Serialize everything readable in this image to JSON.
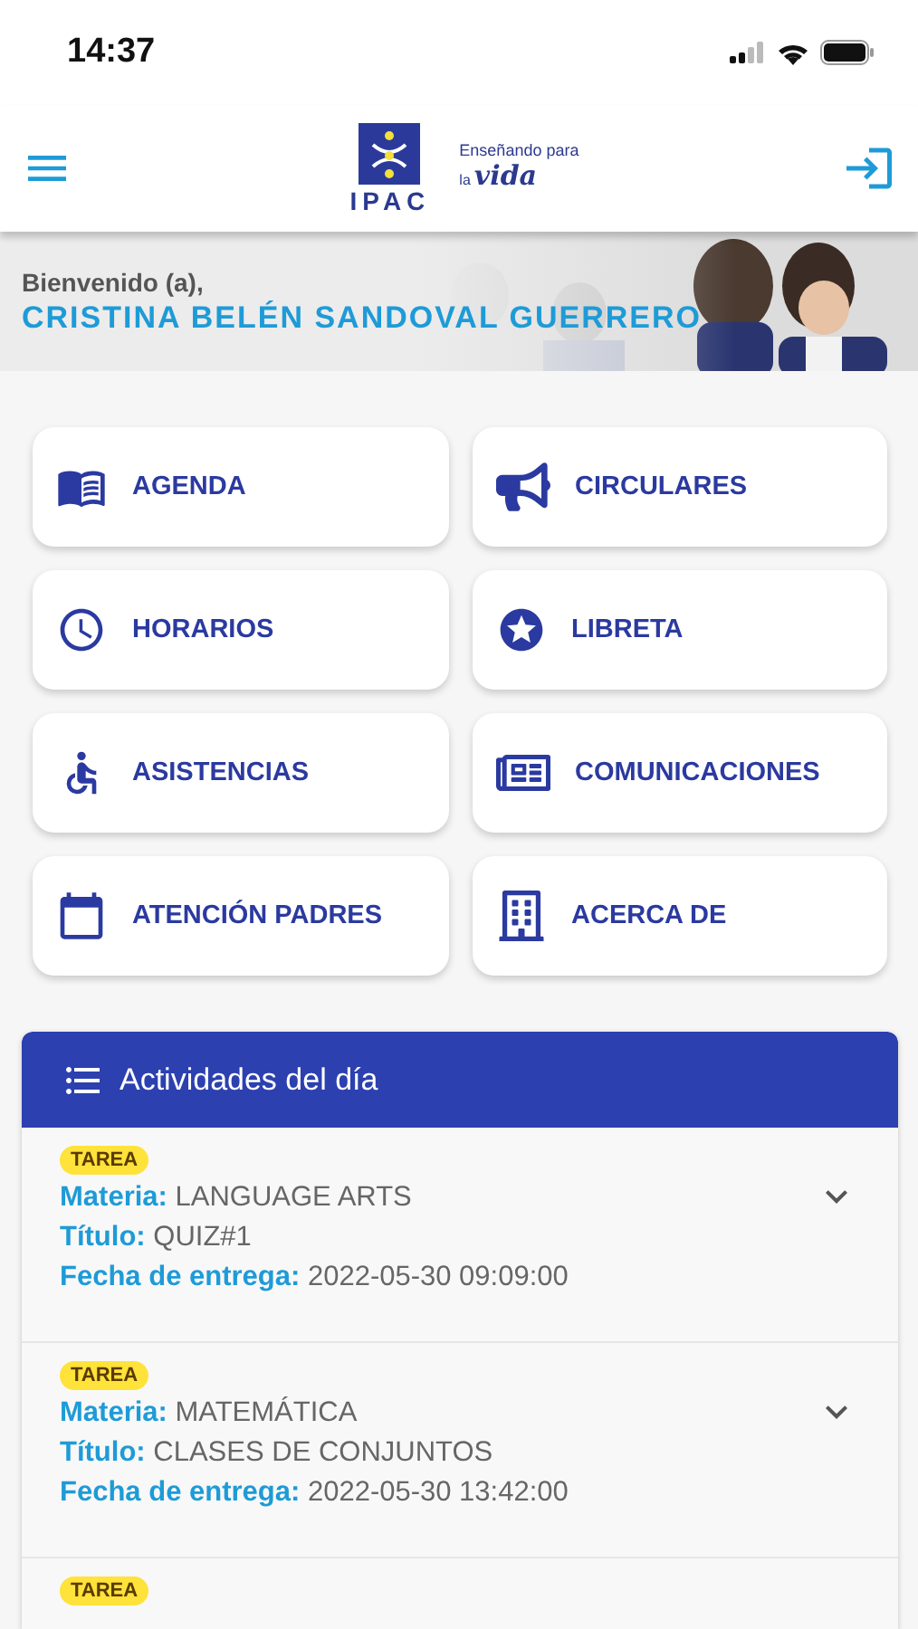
{
  "status_bar": {
    "time": "14:37"
  },
  "header": {
    "logo": {
      "name": "IPAC",
      "tagline_top": "Enseñando para",
      "tagline_small": "la",
      "tagline_script": "vida"
    }
  },
  "welcome": {
    "greeting": "Bienvenido (a),",
    "name": "CRISTINA BELÉN SANDOVAL GUERRERO"
  },
  "menu_tiles": [
    {
      "label": "AGENDA"
    },
    {
      "label": "CIRCULARES"
    },
    {
      "label": "HORARIOS"
    },
    {
      "label": "LIBRETA"
    },
    {
      "label": "ASISTENCIAS"
    },
    {
      "label": "COMUNICACIONES"
    },
    {
      "label": "ATENCIÓN PADRES"
    },
    {
      "label": "ACERCA DE"
    }
  ],
  "activities": {
    "title": "Actividades del día",
    "items": [
      {
        "badge": "TAREA",
        "expanded": false,
        "lines": [
          "**Materia:** LANGUAGE ARTS",
          "**Título:** QUIZ#1",
          "**Fecha de entrega:** 2022-05-30 09:09:00"
        ]
      },
      {
        "badge": "TAREA",
        "expanded": false,
        "lines": [
          "**Materia:** MATEMÁTICA",
          "**Título:** CLASES DE CONJUNTOS",
          "**Fecha de entrega:** 2022-05-30 13:42:00"
        ]
      },
      {
        "badge": "TAREA"
      }
    ]
  }
}
